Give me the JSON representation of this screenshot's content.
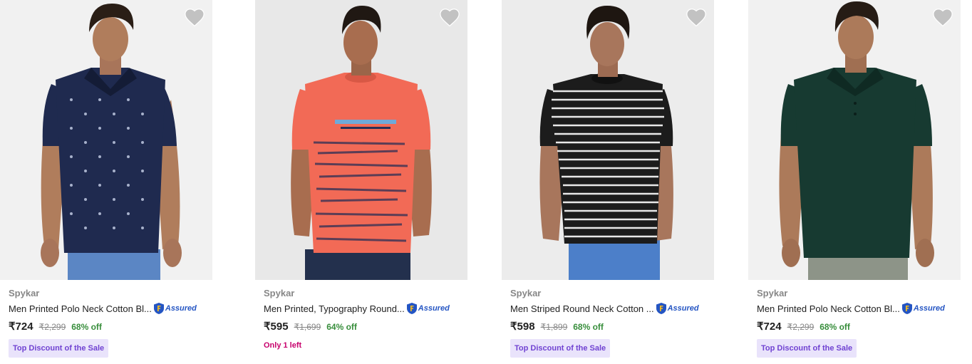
{
  "products": [
    {
      "brand": "Spykar",
      "title": "Men Printed Polo Neck Cotton Bl...",
      "assured_label": "Assured",
      "price": "₹724",
      "mrp": "₹2,299",
      "discount": "68% off",
      "tag": "Top Discount of the Sale",
      "image_alt": "man wearing navy printed polo t-shirt",
      "shirt_color": "#1f2a4f",
      "bg_color": "#f1f1f1"
    },
    {
      "brand": "Spykar",
      "title": "Men Printed, Typography Round...",
      "assured_label": "Assured",
      "price": "₹595",
      "mrp": "₹1,699",
      "discount": "64% off",
      "stock": "Only 1 left",
      "image_alt": "man wearing coral printed round neck t-shirt",
      "shirt_color": "#f26a56",
      "bg_color": "#e8e8e8"
    },
    {
      "brand": "Spykar",
      "title": "Men Striped Round Neck Cotton ...",
      "assured_label": "Assured",
      "price": "₹598",
      "mrp": "₹1,899",
      "discount": "68% off",
      "tag": "Top Discount of the Sale",
      "image_alt": "man wearing black and white striped t-shirt",
      "shirt_color": "#1c1c1c",
      "bg_color": "#ececec"
    },
    {
      "brand": "Spykar",
      "title": "Men Printed Polo Neck Cotton Bl...",
      "assured_label": "Assured",
      "price": "₹724",
      "mrp": "₹2,299",
      "discount": "68% off",
      "tag": "Top Discount of the Sale",
      "image_alt": "man wearing dark green polo t-shirt",
      "shirt_color": "#173a31",
      "bg_color": "#f1f1f1"
    }
  ],
  "colors": {
    "heart": "#c2c2c2",
    "price_off": "#388e3c",
    "tag_bg": "#e9e3fb",
    "tag_text": "#7042d2",
    "assured_blue": "#2455c3",
    "assured_gold": "#f8bd1c",
    "stock_text": "#c7006c"
  }
}
